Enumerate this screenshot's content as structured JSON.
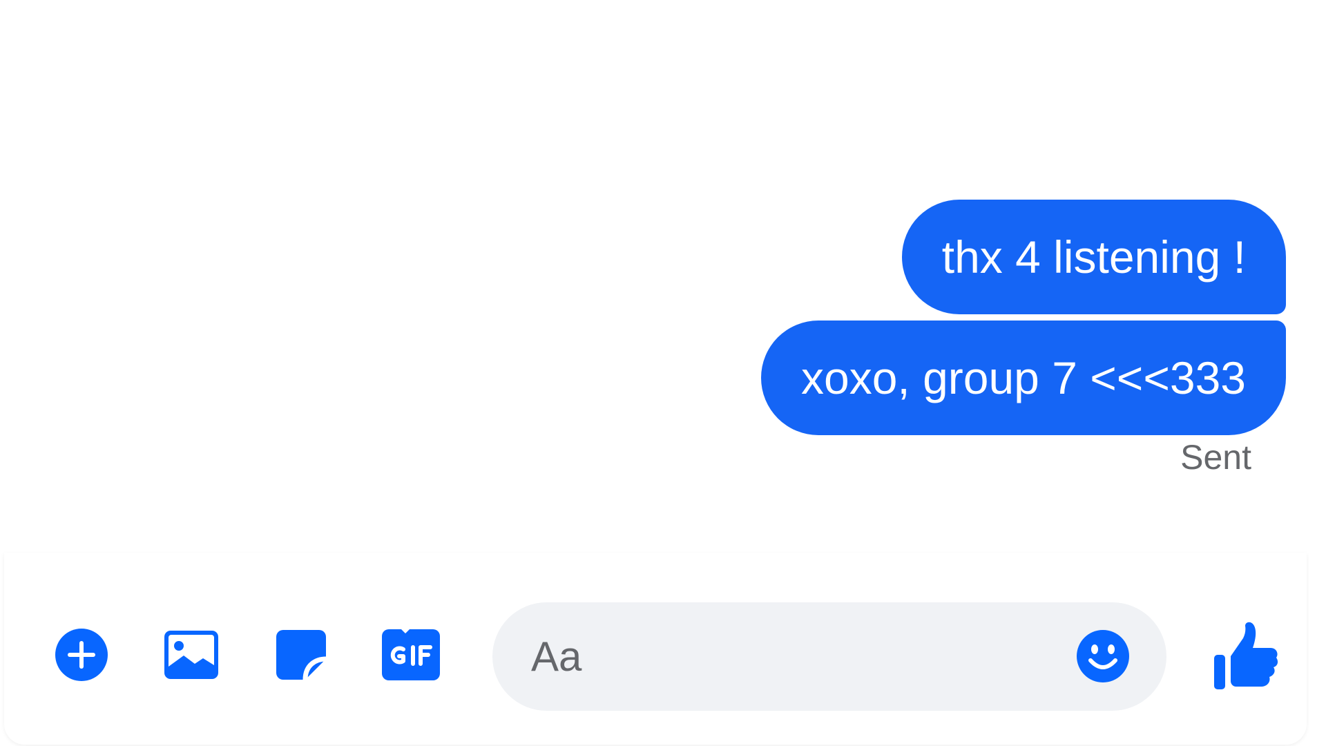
{
  "thread": {
    "messages": [
      {
        "text": "thx 4 listening !"
      },
      {
        "text": "xoxo, group 7 <<<333"
      }
    ],
    "status": "Sent"
  },
  "composer": {
    "icons": [
      "add-icon",
      "image-icon",
      "sticker-icon",
      "gif-icon"
    ],
    "input_placeholder": "Aa",
    "input_value": "",
    "emoji_icon": "smiley-icon",
    "send_icon": "thumbs-up-icon"
  },
  "colors": {
    "accent": "#0866ff",
    "bubble": "#1565f5",
    "input_bg": "#f0f2f5",
    "status_text": "#65676b"
  }
}
